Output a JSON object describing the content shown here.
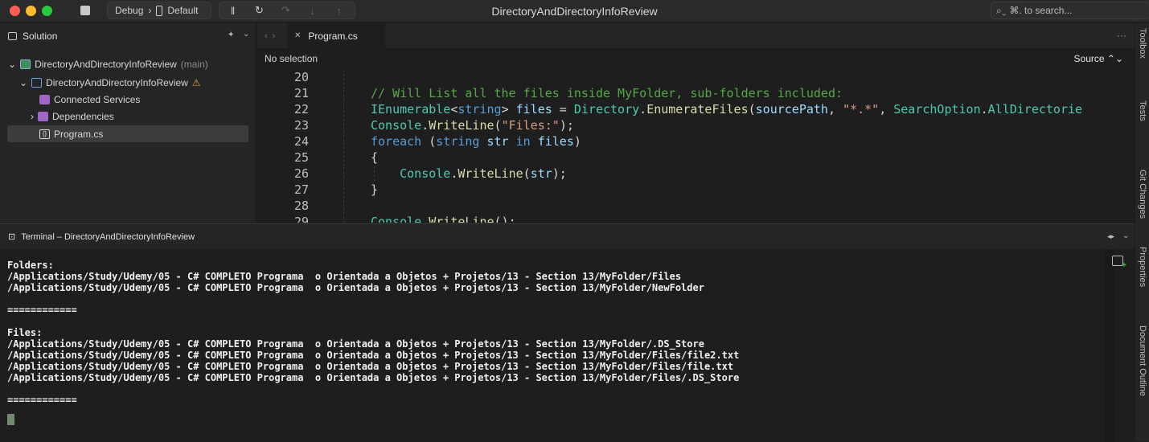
{
  "window": {
    "title": "DirectoryAndDirectoryInfoReview"
  },
  "toolbar": {
    "config": "Debug",
    "config_sep": "›",
    "device": "Default",
    "search_placeholder": "⌘. to search..."
  },
  "solution": {
    "header": "Solution",
    "items": [
      {
        "label": "DirectoryAndDirectoryInfoReview",
        "suffix": "(main)",
        "icon": "solution-icon",
        "expand": "⌄"
      },
      {
        "label": "DirectoryAndDirectoryInfoReview",
        "suffix": "⚠",
        "icon": "project-icon",
        "expand": "⌄"
      },
      {
        "label": "Connected Services",
        "icon": "connected-services-icon"
      },
      {
        "label": "Dependencies",
        "icon": "dependencies-icon",
        "expand": "›"
      },
      {
        "label": "Program.cs",
        "icon": "csharp-file-icon"
      }
    ]
  },
  "editor": {
    "tab": {
      "label": "Program.cs",
      "close": "✕"
    },
    "tab_more": "···",
    "breadcrumb": "No selection",
    "source_menu": "Source ⌃⌄",
    "code_lines": [
      {
        "n": "20",
        "segs": []
      },
      {
        "n": "21",
        "segs": [
          {
            "c": "cm",
            "t": "// Will List all the files inside MyFolder, sub-folders included:"
          }
        ]
      },
      {
        "n": "22",
        "segs": [
          {
            "c": "ty",
            "t": "IEnumerable"
          },
          {
            "c": "pl",
            "t": "<"
          },
          {
            "c": "kw",
            "t": "string"
          },
          {
            "c": "pl",
            "t": "> "
          },
          {
            "c": "vr",
            "t": "files"
          },
          {
            "c": "pl",
            "t": " = "
          },
          {
            "c": "ty",
            "t": "Directory"
          },
          {
            "c": "pl",
            "t": "."
          },
          {
            "c": "fn",
            "t": "EnumerateFiles"
          },
          {
            "c": "pl",
            "t": "("
          },
          {
            "c": "vr",
            "t": "sourcePath"
          },
          {
            "c": "pl",
            "t": ", "
          },
          {
            "c": "st",
            "t": "\"*.*\""
          },
          {
            "c": "pl",
            "t": ", "
          },
          {
            "c": "ty",
            "t": "SearchOption"
          },
          {
            "c": "pl",
            "t": "."
          },
          {
            "c": "ty",
            "t": "AllDirectorie"
          }
        ]
      },
      {
        "n": "23",
        "segs": [
          {
            "c": "ty",
            "t": "Console"
          },
          {
            "c": "pl",
            "t": "."
          },
          {
            "c": "fn",
            "t": "WriteLine"
          },
          {
            "c": "pl",
            "t": "("
          },
          {
            "c": "st",
            "t": "\"Files:\""
          },
          {
            "c": "pl",
            "t": ");"
          }
        ]
      },
      {
        "n": "24",
        "segs": [
          {
            "c": "kw",
            "t": "foreach"
          },
          {
            "c": "pl",
            "t": " ("
          },
          {
            "c": "kw",
            "t": "string"
          },
          {
            "c": "pl",
            "t": " "
          },
          {
            "c": "vr",
            "t": "str"
          },
          {
            "c": "pl",
            "t": " "
          },
          {
            "c": "kw",
            "t": "in"
          },
          {
            "c": "pl",
            "t": " "
          },
          {
            "c": "vr",
            "t": "files"
          },
          {
            "c": "pl",
            "t": ")"
          }
        ]
      },
      {
        "n": "25",
        "segs": [
          {
            "c": "pl",
            "t": "{"
          }
        ]
      },
      {
        "n": "26",
        "segs": [
          {
            "c": "pl",
            "t": "    "
          },
          {
            "c": "ty",
            "t": "Console"
          },
          {
            "c": "pl",
            "t": "."
          },
          {
            "c": "fn",
            "t": "WriteLine"
          },
          {
            "c": "pl",
            "t": "("
          },
          {
            "c": "vr",
            "t": "str"
          },
          {
            "c": "pl",
            "t": ");"
          }
        ]
      },
      {
        "n": "27",
        "segs": [
          {
            "c": "pl",
            "t": "}"
          }
        ]
      },
      {
        "n": "28",
        "segs": []
      },
      {
        "n": "29",
        "segs": [
          {
            "c": "ty",
            "t": "Console"
          },
          {
            "c": "pl",
            "t": "."
          },
          {
            "c": "fn",
            "t": "WriteLine"
          },
          {
            "c": "pl",
            "t": "();"
          }
        ]
      }
    ]
  },
  "terminal": {
    "title": "Terminal – DirectoryAndDirectoryInfoReview",
    "output": "Folders:\n/Applications/Study/Udemy/05 - C# COMPLETO Programa  o Orientada a Objetos + Projetos/13 - Section 13/MyFolder/Files\n/Applications/Study/Udemy/05 - C# COMPLETO Programa  o Orientada a Objetos + Projetos/13 - Section 13/MyFolder/NewFolder\n\n============\n\nFiles:\n/Applications/Study/Udemy/05 - C# COMPLETO Programa  o Orientada a Objetos + Projetos/13 - Section 13/MyFolder/.DS_Store\n/Applications/Study/Udemy/05 - C# COMPLETO Programa  o Orientada a Objetos + Projetos/13 - Section 13/MyFolder/Files/file2.txt\n/Applications/Study/Udemy/05 - C# COMPLETO Programa  o Orientada a Objetos + Projetos/13 - Section 13/MyFolder/Files/file.txt\n/Applications/Study/Udemy/05 - C# COMPLETO Programa  o Orientada a Objetos + Projetos/13 - Section 13/MyFolder/Files/.DS_Store\n\n============"
  },
  "right_pads": [
    "Toolbox",
    "Tests",
    "Git Changes",
    "Properties",
    "Document Outline"
  ]
}
